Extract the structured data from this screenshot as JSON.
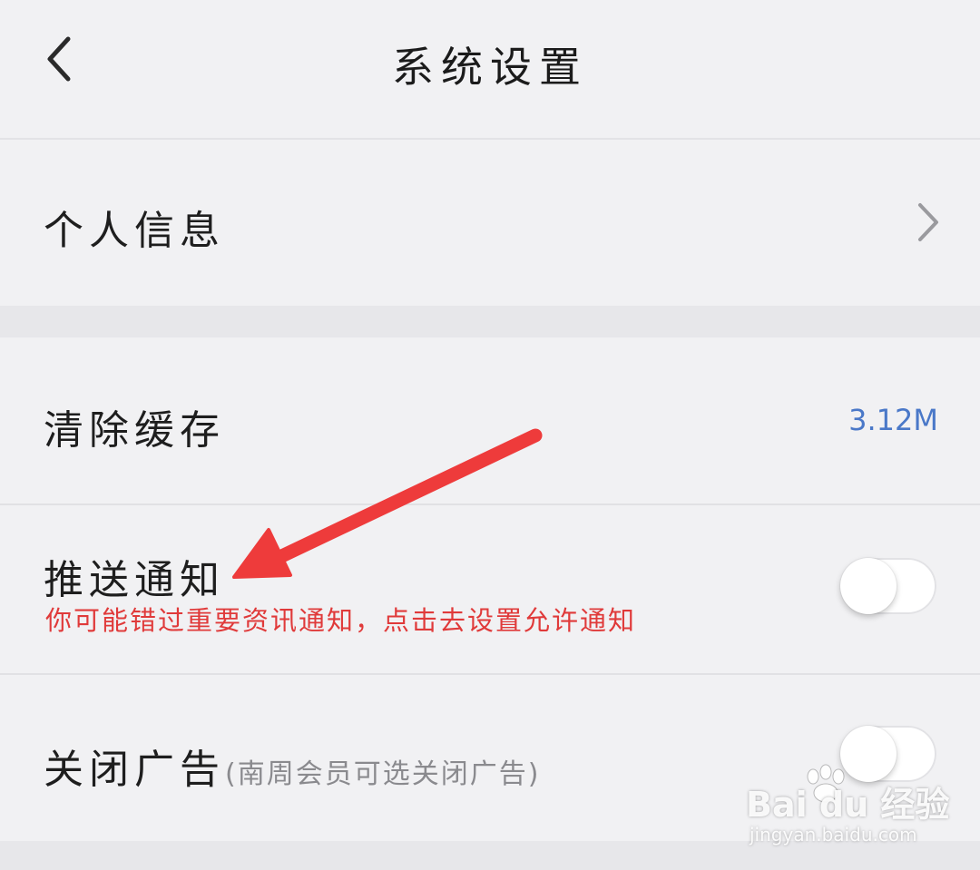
{
  "header": {
    "title": "系统设置",
    "back_icon": "chevron-left-icon"
  },
  "settings": {
    "personal_info": {
      "label": "个人信息",
      "icon": "chevron-right-icon"
    },
    "clear_cache": {
      "label": "清除缓存",
      "value": "3.12M"
    },
    "push_notification": {
      "label": "推送通知",
      "warning": "你可能错过重要资讯通知，点击去设置允许通知",
      "enabled": false
    },
    "close_ads": {
      "label": "关闭广告",
      "hint": "(南周会员可选关闭广告)",
      "enabled": false
    }
  },
  "annotation": {
    "arrow_color": "#ee3b3b"
  },
  "watermark": {
    "brand": "Bai du 经验",
    "url": "jingyan.baidu.com"
  },
  "colors": {
    "background": "#f1f1f3",
    "section_gap": "#e7e7ea",
    "value_blue": "#4a78c8",
    "warning_red": "#e03a3a"
  }
}
